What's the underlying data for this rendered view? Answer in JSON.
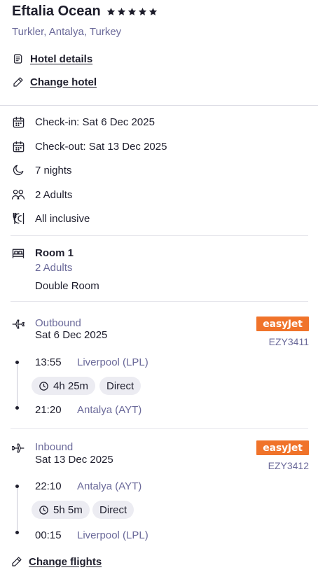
{
  "hotel": {
    "name": "Eftalia Ocean",
    "stars": 5,
    "location": "Turkler, Antalya, Turkey",
    "details_link": "Hotel details",
    "change_link": "Change hotel"
  },
  "stay": {
    "check_in": "Check-in: Sat 6 Dec 2025",
    "check_out": "Check-out: Sat 13 Dec 2025",
    "nights": "7 nights",
    "guests": "2 Adults",
    "board": "All inclusive"
  },
  "room": {
    "title": "Room 1",
    "guests": "2 Adults",
    "type": "Double Room"
  },
  "outbound": {
    "label": "Outbound",
    "date": "Sat 6 Dec 2025",
    "airline": "easyJet",
    "flight_no": "EZY3411",
    "depart_time": "13:55",
    "depart_airport": "Liverpool (LPL)",
    "duration": "4h 25m",
    "stops": "Direct",
    "arrive_time": "21:20",
    "arrive_airport": "Antalya (AYT)"
  },
  "inbound": {
    "label": "Inbound",
    "date": "Sat 13 Dec 2025",
    "airline": "easyJet",
    "flight_no": "EZY3412",
    "depart_time": "22:10",
    "depart_airport": "Antalya (AYT)",
    "duration": "5h 5m",
    "stops": "Direct",
    "arrive_time": "00:15",
    "arrive_airport": "Liverpool (LPL)"
  },
  "change_flights_link": "Change flights",
  "colors": {
    "airline_brand": "#f0732a",
    "muted_text": "#6b6a9a",
    "chip_bg": "#ececf2"
  }
}
